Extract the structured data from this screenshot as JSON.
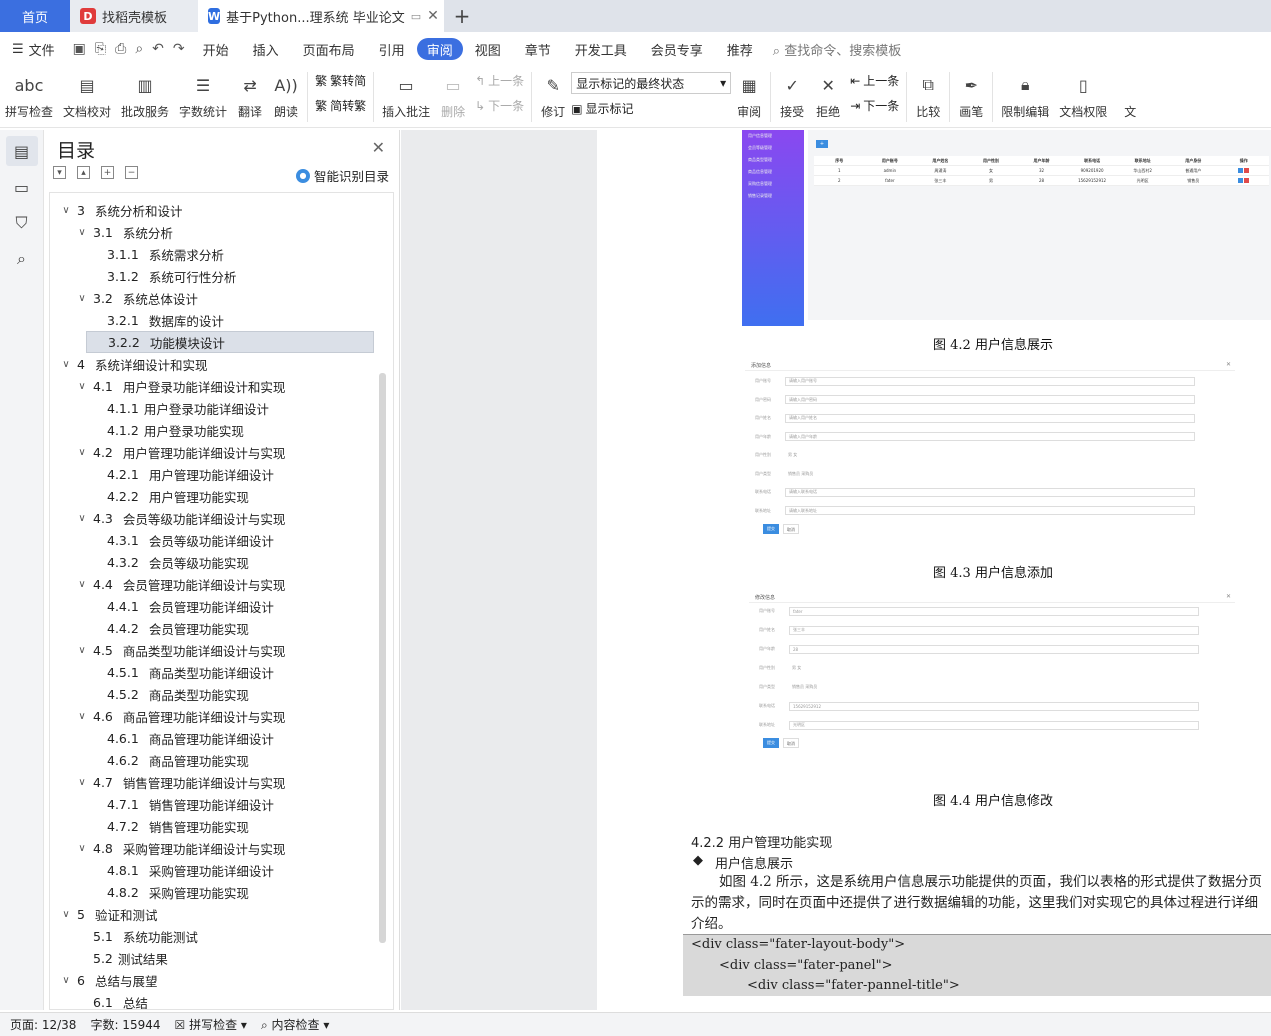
{
  "tabs": {
    "home": "首页",
    "template": "找稻壳模板",
    "document": "基于Python...理系统 毕业论文"
  },
  "menu": {
    "file": "文件",
    "items": [
      "开始",
      "插入",
      "页面布局",
      "引用",
      "审阅",
      "视图",
      "章节",
      "开发工具",
      "会员专享",
      "推荐"
    ],
    "active": "审阅",
    "search": "查找命令、搜索模板"
  },
  "ribbon": {
    "spell": "拼写检查",
    "proof": "文档校对",
    "correction": "批改服务",
    "wordcount": "字数统计",
    "translate": "翻译",
    "read": "朗读",
    "trad": "繁转简",
    "simp": "简转繁",
    "insert_comment": "插入批注",
    "delete": "删除",
    "prev": "上一条",
    "next": "下一条",
    "track": "修订",
    "markstate": "显示标记的最终状态",
    "showmark": "显示标记",
    "review": "审阅",
    "accept": "接受",
    "reject": "拒绝",
    "prev2": "上一条",
    "next2": "下一条",
    "compare": "比较",
    "pen": "画笔",
    "restrict": "限制编辑",
    "rights": "文档权限",
    "more": "文"
  },
  "toc": {
    "title": "目录",
    "smart": "智能识别目录",
    "items": [
      {
        "num": "3",
        "text": "系统分析和设计",
        "level": 1,
        "chev": true
      },
      {
        "num": "3.1",
        "text": "系统分析",
        "level": 2,
        "chev": true
      },
      {
        "num": "3.1.1",
        "text": "系统需求分析",
        "level": 3
      },
      {
        "num": "3.1.2",
        "text": "系统可行性分析",
        "level": 3
      },
      {
        "num": "3.2",
        "text": "系统总体设计",
        "level": 2,
        "chev": true
      },
      {
        "num": "3.2.1",
        "text": "数据库的设计",
        "level": 3
      },
      {
        "num": "3.2.2",
        "text": "功能模块设计",
        "level": 3,
        "selected": true
      },
      {
        "num": "4",
        "text": "系统详细设计和实现",
        "level": 1,
        "chev": true
      },
      {
        "num": "4.1",
        "text": "用户登录功能详细设计和实现",
        "level": 2,
        "chev": true
      },
      {
        "num": "4.1.1",
        "text": "用户登录功能详细设计",
        "level": 3,
        "tight": true
      },
      {
        "num": "4.1.2",
        "text": "用户登录功能实现",
        "level": 3,
        "tight": true
      },
      {
        "num": "4.2",
        "text": "用户管理功能详细设计与实现",
        "level": 2,
        "chev": true
      },
      {
        "num": "4.2.1",
        "text": "用户管理功能详细设计",
        "level": 3
      },
      {
        "num": "4.2.2",
        "text": "用户管理功能实现",
        "level": 3
      },
      {
        "num": "4.3",
        "text": "会员等级功能详细设计与实现",
        "level": 2,
        "chev": true
      },
      {
        "num": "4.3.1",
        "text": "会员等级功能详细设计",
        "level": 3
      },
      {
        "num": "4.3.2",
        "text": "会员等级功能实现",
        "level": 3
      },
      {
        "num": "4.4",
        "text": "会员管理功能详细设计与实现",
        "level": 2,
        "chev": true
      },
      {
        "num": "4.4.1",
        "text": "会员管理功能详细设计",
        "level": 3
      },
      {
        "num": "4.4.2",
        "text": "会员管理功能实现",
        "level": 3
      },
      {
        "num": "4.5",
        "text": "商品类型功能详细设计与实现",
        "level": 2,
        "chev": true
      },
      {
        "num": "4.5.1",
        "text": "商品类型功能详细设计",
        "level": 3
      },
      {
        "num": "4.5.2",
        "text": "商品类型功能实现",
        "level": 3
      },
      {
        "num": "4.6",
        "text": "商品管理功能详细设计与实现",
        "level": 2,
        "chev": true
      },
      {
        "num": "4.6.1",
        "text": "商品管理功能详细设计",
        "level": 3
      },
      {
        "num": "4.6.2",
        "text": "商品管理功能实现",
        "level": 3
      },
      {
        "num": "4.7",
        "text": "销售管理功能详细设计与实现",
        "level": 2,
        "chev": true
      },
      {
        "num": "4.7.1",
        "text": "销售管理功能详细设计",
        "level": 3
      },
      {
        "num": "4.7.2",
        "text": "销售管理功能实现",
        "level": 3
      },
      {
        "num": "4.8",
        "text": "采购管理功能详细设计与实现",
        "level": 2,
        "chev": true
      },
      {
        "num": "4.8.1",
        "text": "采购管理功能详细设计",
        "level": 3
      },
      {
        "num": "4.8.2",
        "text": "采购管理功能实现",
        "level": 3
      },
      {
        "num": "5",
        "text": "验证和测试",
        "level": 1,
        "chev": true
      },
      {
        "num": "5.1",
        "text": "系统功能测试",
        "level": 2
      },
      {
        "num": "5.2",
        "text": "测试结果",
        "level": 2,
        "tight": true
      },
      {
        "num": "6",
        "text": "总结与展望",
        "level": 1,
        "chev": true
      },
      {
        "num": "6.1",
        "text": "总结",
        "level": 2
      }
    ]
  },
  "doc": {
    "fig42": "图 4.2 用户信息展示",
    "fig43": "图 4.3 用户信息添加",
    "fig44": "图 4.4 用户信息修改",
    "heading": "4.2.2   用户管理功能实现",
    "bullet": "用户信息展示",
    "para1": "如图 4.2 所示，这是系统用户信息展示功能提供的页面，我们以表格的形式提供了数据分页",
    "para2": "示的需求，同时在页面中还提供了进行数据编辑的功能，这里我们对实现它的具体过程进行详细",
    "para3": "介绍。",
    "code1": "<div class=\"fater-layout-body\">",
    "code2": "<div class=\"fater-panel\">",
    "code3": "<div class=\"fater-pannel-title\">",
    "fig_table": {
      "headers": [
        "序号",
        "用户账号",
        "用户姓名",
        "用户性别",
        "用户年龄",
        "联系电话",
        "联系地址",
        "用户身份",
        "操作"
      ],
      "rows": [
        [
          "1",
          "admin",
          "周涌涛",
          "女",
          "32",
          "909201920",
          "华山西村2",
          "普通用户"
        ],
        [
          "2",
          "fater",
          "张三丰",
          "男",
          "28",
          "15629152912",
          "光明区",
          "销售员"
        ]
      ]
    },
    "sidebar_menu": [
      "用户信息管理",
      "会员等级管理",
      "商品类型管理",
      "商品信息管理",
      "采购信息管理",
      "销售记录管理"
    ],
    "add_form": {
      "title": "添加信息",
      "fields": [
        [
          "用户账号",
          "请输入用户账号"
        ],
        [
          "用户密码",
          "请输入用户密码"
        ],
        [
          "用户姓名",
          "请输入用户姓名"
        ],
        [
          "用户年龄",
          "请输入用户年龄"
        ],
        [
          "用户性别",
          "男  女"
        ],
        [
          "用户类型",
          "销售员  采购员"
        ],
        [
          "联系电话",
          "请输入联系电话"
        ],
        [
          "联系地址",
          "请输入联系地址"
        ]
      ],
      "submit": "提交",
      "cancel": "取消"
    },
    "edit_form": {
      "title": "修改信息",
      "fields": [
        [
          "用户账号",
          "fater"
        ],
        [
          "用户姓名",
          "张三丰"
        ],
        [
          "用户年龄",
          "28"
        ],
        [
          "用户性别",
          "男  女"
        ],
        [
          "用户类型",
          "销售员  采购员"
        ],
        [
          "联系电话",
          "15629152912"
        ],
        [
          "联系地址",
          "光明区"
        ]
      ],
      "submit": "提交",
      "cancel": "取消"
    }
  },
  "status": {
    "page": "页面: 12/38",
    "words": "字数: 15944",
    "spell": "拼写检查",
    "content": "内容检查"
  },
  "colors": {
    "accent": "#3b6fe0",
    "sidebar_grad_top": "#8a48f0",
    "sidebar_grad_bottom": "#3f6ff0"
  }
}
